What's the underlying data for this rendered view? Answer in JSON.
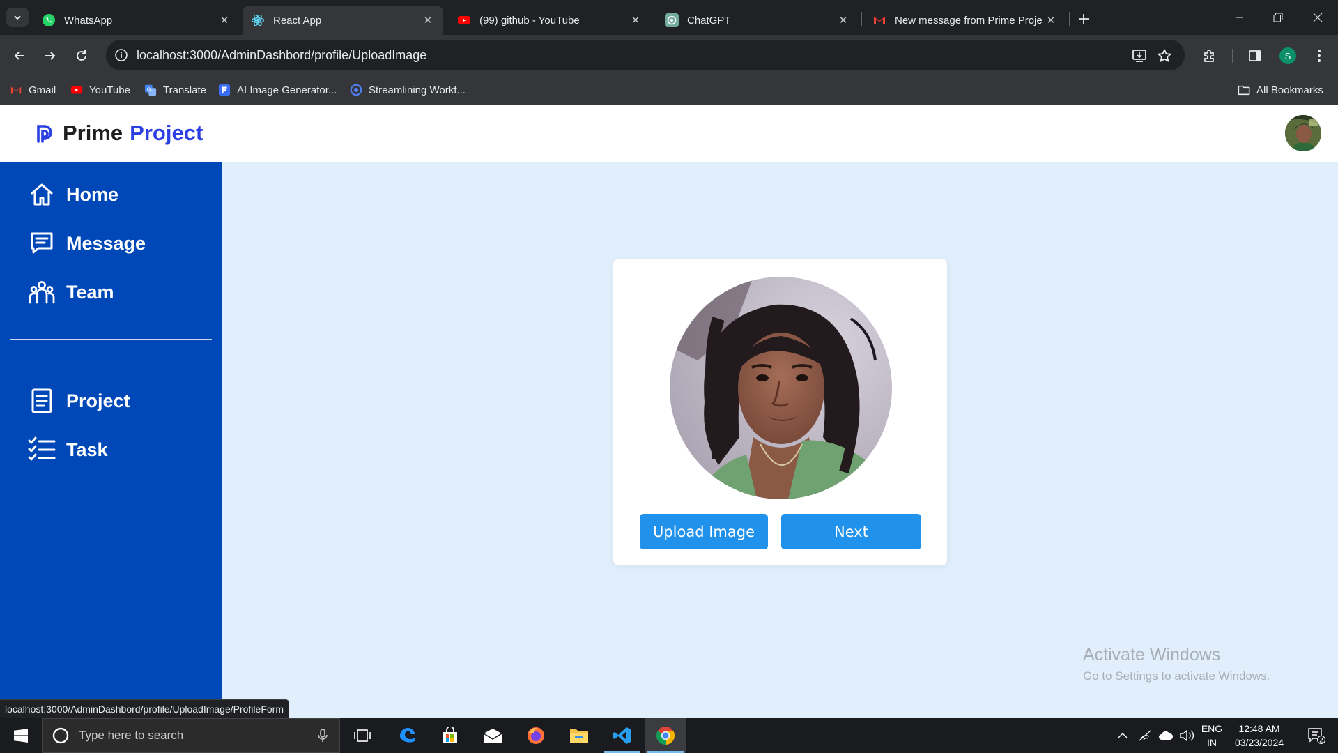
{
  "browser": {
    "tabs": [
      {
        "title": "WhatsApp",
        "icon": "whatsapp-icon",
        "active": false
      },
      {
        "title": "React App",
        "icon": "react-icon",
        "active": true
      },
      {
        "title": "(99) github - YouTube",
        "icon": "youtube-icon",
        "active": false
      },
      {
        "title": "ChatGPT",
        "icon": "chatgpt-icon",
        "active": false
      },
      {
        "title": "New message from Prime Proje",
        "icon": "gmail-icon",
        "active": false
      }
    ],
    "url": "localhost:3000/AdminDashbord/profile/UploadImage",
    "profile_initial": "S",
    "bookmarks": [
      {
        "label": "Gmail",
        "icon": "gmail-icon"
      },
      {
        "label": "YouTube",
        "icon": "youtube-icon"
      },
      {
        "label": "Translate",
        "icon": "translate-icon"
      },
      {
        "label": "AI Image Generator...",
        "icon": "ai-image-icon"
      },
      {
        "label": "Streamlining Workf...",
        "icon": "streamlining-icon"
      }
    ],
    "all_bookmarks": "All Bookmarks",
    "status_url": "localhost:3000/AdminDashbord/profile/UploadImage/ProfileForm"
  },
  "app": {
    "brand": {
      "part1": "Prime",
      "part2": "Project"
    },
    "sidebar": {
      "items": [
        {
          "label": "Home",
          "icon": "home-icon"
        },
        {
          "label": "Message",
          "icon": "message-icon"
        },
        {
          "label": "Team",
          "icon": "team-icon"
        },
        {
          "label": "Project",
          "icon": "project-icon"
        },
        {
          "label": "Task",
          "icon": "task-icon"
        }
      ]
    },
    "card": {
      "upload_label": "Upload Image",
      "next_label": "Next"
    },
    "colors": {
      "sidebar": "#0048b7",
      "background": "#e1effd",
      "button": "#2192ec",
      "brand_accent": "#2b3fe3"
    }
  },
  "watermark": {
    "line1": "Activate Windows",
    "line2": "Go to Settings to activate Windows."
  },
  "taskbar": {
    "search_placeholder": "Type here to search",
    "lang_line1": "ENG",
    "lang_line2": "IN",
    "time": "12:48 AM",
    "date": "03/23/2024",
    "notification_count": "2"
  }
}
